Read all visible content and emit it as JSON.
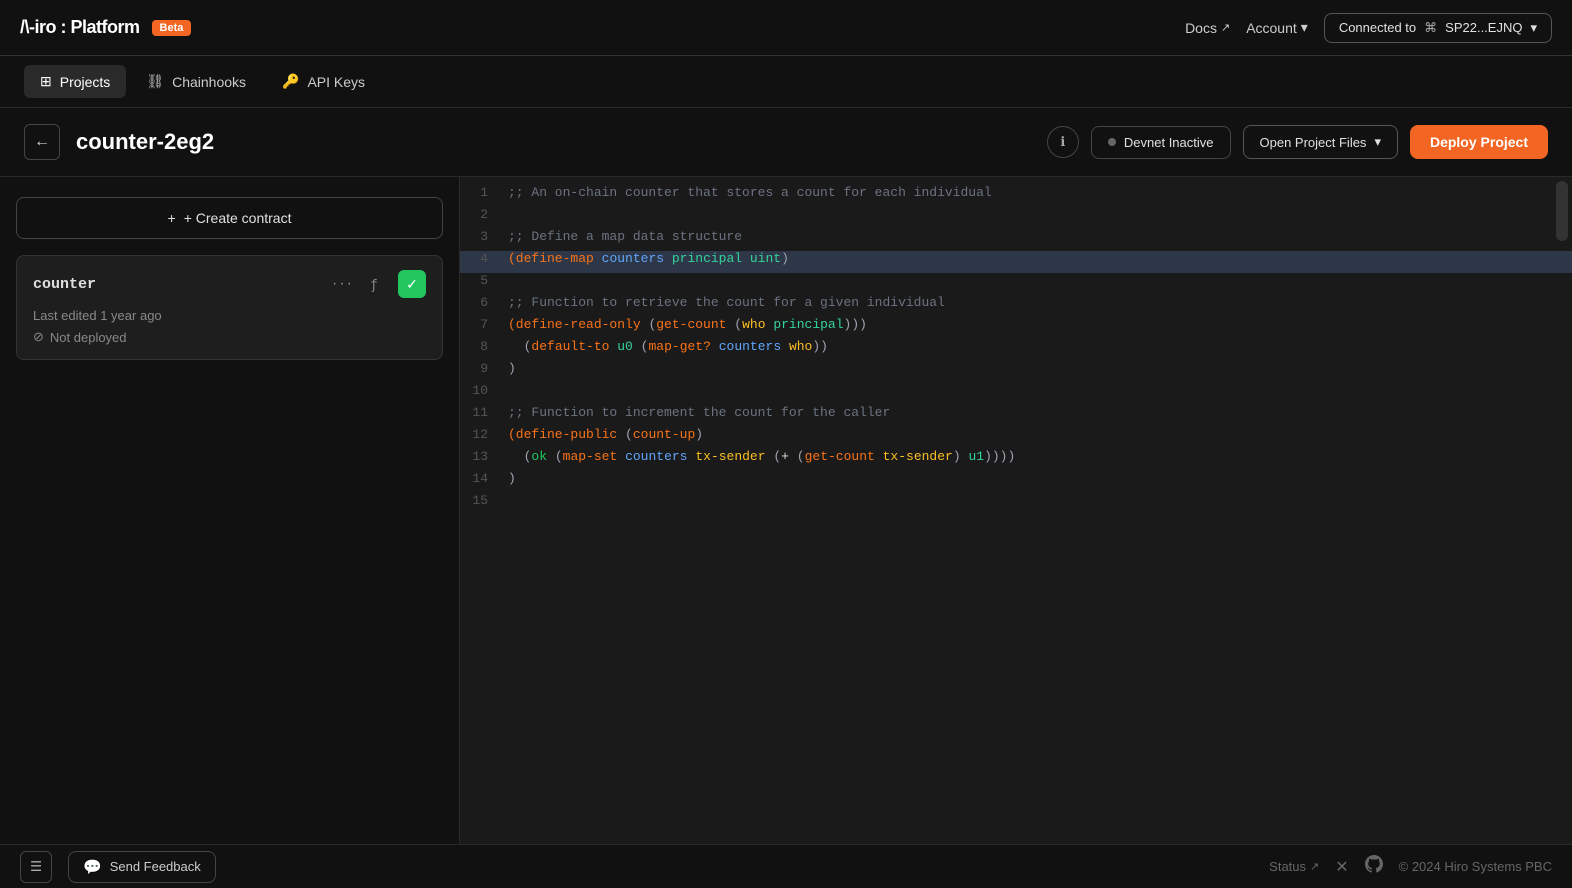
{
  "app": {
    "logo": "/\\-iro : Platform",
    "beta_label": "Beta"
  },
  "topnav": {
    "docs_label": "Docs",
    "account_label": "Account",
    "connected_label": "Connected to",
    "wallet_address": "SP22...EJNQ"
  },
  "secondnav": {
    "tabs": [
      {
        "id": "projects",
        "label": "Projects",
        "icon": "list"
      },
      {
        "id": "chainhooks",
        "label": "Chainhooks",
        "icon": "chain"
      },
      {
        "id": "api-keys",
        "label": "API Keys",
        "icon": "key"
      }
    ],
    "active_tab": "projects"
  },
  "project_header": {
    "back_label": "←",
    "project_name": "counter-2eg2",
    "devnet_label": "Devnet Inactive",
    "open_files_label": "Open Project Files",
    "deploy_label": "Deploy Project"
  },
  "sidebar": {
    "create_contract_label": "+ Create contract",
    "contract": {
      "name": "counter",
      "last_edited": "Last edited 1 year ago",
      "deployment_status": "Not deployed"
    }
  },
  "code_editor": {
    "lines": [
      {
        "num": 1,
        "content": ";; An on-chain counter that stores a count for each individual",
        "type": "comment"
      },
      {
        "num": 2,
        "content": "",
        "type": "empty"
      },
      {
        "num": 3,
        "content": ";; Define a map data structure",
        "type": "comment"
      },
      {
        "num": 4,
        "content": "(define-map counters principal uint)",
        "type": "code",
        "highlighted": true
      },
      {
        "num": 5,
        "content": "",
        "type": "empty"
      },
      {
        "num": 6,
        "content": ";; Function to retrieve the count for a given individual",
        "type": "comment"
      },
      {
        "num": 7,
        "content": "(define-read-only (get-count (who principal))",
        "type": "code"
      },
      {
        "num": 8,
        "content": "  (default-to u0 (map-get? counters who))",
        "type": "code"
      },
      {
        "num": 9,
        "content": ")",
        "type": "code"
      },
      {
        "num": 10,
        "content": "",
        "type": "empty"
      },
      {
        "num": 11,
        "content": ";; Function to increment the count for the caller",
        "type": "comment"
      },
      {
        "num": 12,
        "content": "(define-public (count-up)",
        "type": "code"
      },
      {
        "num": 13,
        "content": "  (ok (map-set counters tx-sender (+ (get-count tx-sender) u1)))",
        "type": "code"
      },
      {
        "num": 14,
        "content": ")",
        "type": "code"
      },
      {
        "num": 15,
        "content": "",
        "type": "empty"
      }
    ]
  },
  "footer": {
    "hamburger_label": "≡",
    "feedback_label": "Send Feedback",
    "status_label": "Status",
    "copyright": "© 2024 Hiro Systems PBC"
  }
}
